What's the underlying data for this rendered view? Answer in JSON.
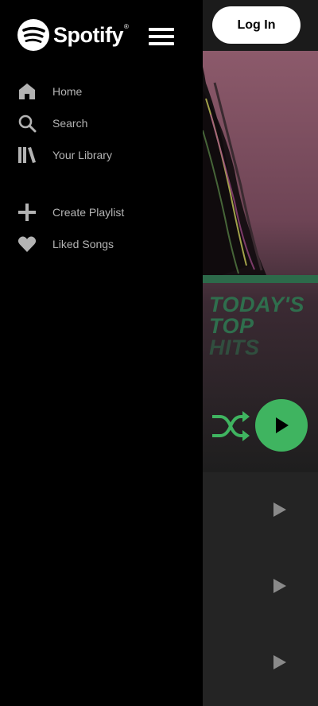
{
  "header": {
    "login_label": "Log In"
  },
  "sidebar": {
    "logo_text": "Spotify",
    "logo_mark": "®",
    "primary_items": [
      {
        "label": "Home",
        "icon": "home-icon"
      },
      {
        "label": "Search",
        "icon": "search-icon"
      },
      {
        "label": "Your Library",
        "icon": "library-icon"
      }
    ],
    "secondary_items": [
      {
        "label": "Create Playlist",
        "icon": "plus-icon"
      },
      {
        "label": "Liked Songs",
        "icon": "heart-icon"
      }
    ]
  },
  "main": {
    "cover_title_lines": [
      "TODAY'S",
      "TOP",
      "HITS"
    ],
    "colors": {
      "accent": "#3fb460",
      "sidebar_bg": "#000000",
      "cover_text": "#2f6e4d"
    },
    "track_count": 3
  }
}
